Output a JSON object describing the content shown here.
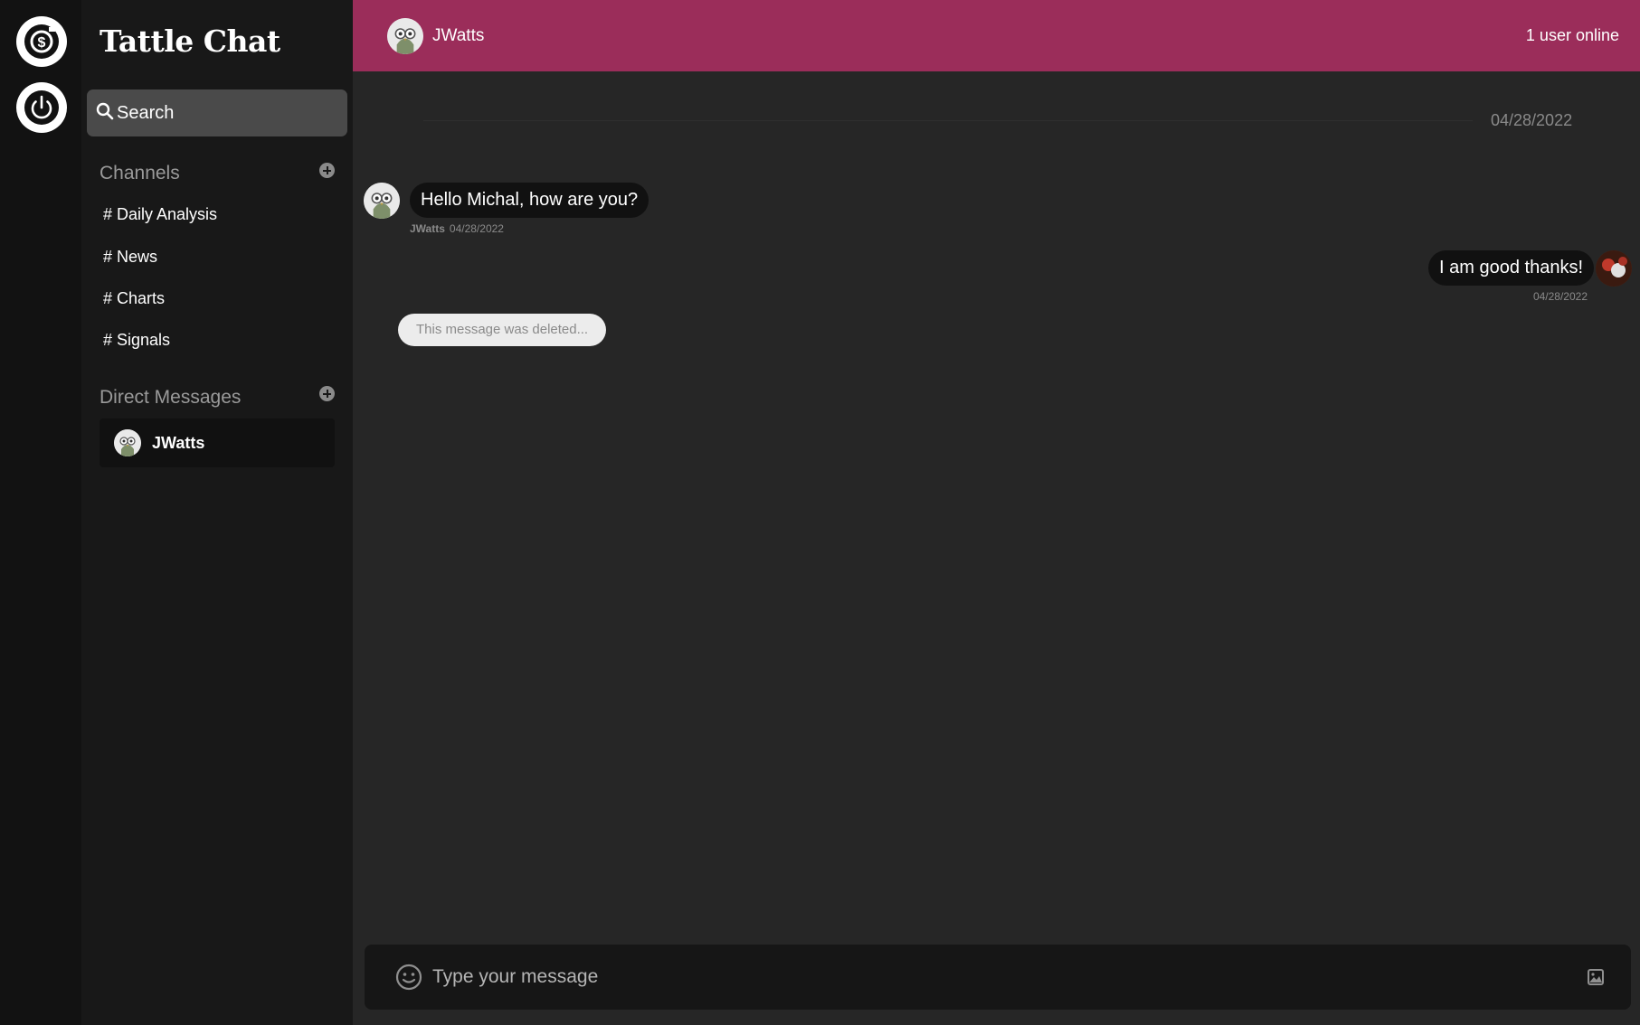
{
  "app": {
    "brand": "Tattle Chat"
  },
  "rail": {
    "items": [
      {
        "icon": "dollar-circle-icon"
      },
      {
        "icon": "power-icon"
      }
    ]
  },
  "sidebar": {
    "search_placeholder": "Search",
    "channels_header": "Channels",
    "channels": [
      {
        "label": "# Daily Analysis"
      },
      {
        "label": "# News"
      },
      {
        "label": "# Charts"
      },
      {
        "label": "# Signals"
      }
    ],
    "dm_header": "Direct Messages",
    "dms": [
      {
        "name": "JWatts",
        "active": true
      }
    ]
  },
  "chat": {
    "contact_name": "JWatts",
    "online_status": "1 user online",
    "date_divider": "04/28/2022",
    "messages": [
      {
        "direction": "incoming",
        "text": "Hello Michal, how are you?",
        "author": "JWatts",
        "date": "04/28/2022"
      },
      {
        "direction": "outgoing",
        "text": "I am good thanks!",
        "date": "04/28/2022"
      },
      {
        "direction": "incoming",
        "deleted": true,
        "text": "This message was deleted..."
      }
    ]
  },
  "composer": {
    "placeholder": "Type your message"
  },
  "colors": {
    "rail_bg": "#121212",
    "sidebar_bg": "#181818",
    "main_bg": "#262626",
    "header_bg": "#9b2d5a",
    "bubble_bg": "#111111",
    "search_bg": "#4a4a4a",
    "muted_text": "#8a8a8a"
  }
}
